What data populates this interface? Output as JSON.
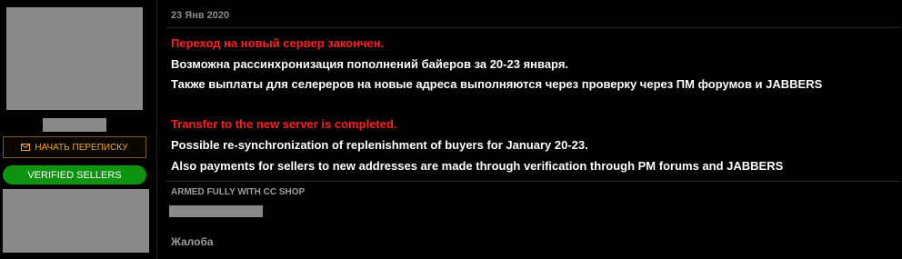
{
  "colors": {
    "background": "#000000",
    "accent_orange": "#f2a81d",
    "verified_green": "#0e9410",
    "announcement_red": "#ff1f1f",
    "text_white": "#ffffff",
    "muted_gray": "#9c9c9c",
    "redaction_gray": "#8a8a8a"
  },
  "user": {
    "pm_button": {
      "icon": "envelope-icon",
      "label": "НАЧАТЬ ПЕРЕПИСКУ"
    },
    "badge_label": "VERIFIED SELLERS"
  },
  "post": {
    "date": "23 Янв 2020",
    "lines": [
      "Переход на новый сервер закончен.",
      "Возможна рассинхронизация пополнений байеров за 20-23 января.",
      "Также выплаты для селереров на новые адреса выполняются через проверку через ПМ форумов и JABBERS",
      "Transfer to the new server is completed.",
      "Possible re-synchronization of replenishment of buyers for January 20-23.",
      "Also payments for sellers to new addresses are made through verification through PM forums and JABBERS"
    ],
    "signature": "ARMED FULLY WITH CC SHOP",
    "report_label": "Жалоба"
  }
}
